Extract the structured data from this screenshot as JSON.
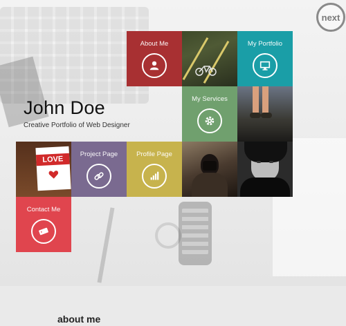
{
  "nav": {
    "next_label": "next"
  },
  "identity": {
    "name": "John Doe",
    "tagline": "Creative Portfolio of Web Designer"
  },
  "tiles": {
    "about": {
      "label": "About Me",
      "color": "#a83032",
      "icon": "user-icon"
    },
    "portfolio": {
      "label": "My Portfolio",
      "color": "#1a9ea7",
      "icon": "monitor-icon"
    },
    "services": {
      "label": "My Services",
      "color": "#70a06e",
      "icon": "gear-icon"
    },
    "project": {
      "label": "Project Page",
      "color": "#7a6a90",
      "icon": "link-icon"
    },
    "profile": {
      "label": "Profile Page",
      "color": "#c7b34d",
      "icon": "bar-chart-icon"
    },
    "contact": {
      "label": "Contact Me",
      "color": "#e0454e",
      "icon": "ticket-icon"
    }
  },
  "photos": {
    "love_card_text": "LOVE"
  },
  "about_section": {
    "heading": "about me"
  }
}
